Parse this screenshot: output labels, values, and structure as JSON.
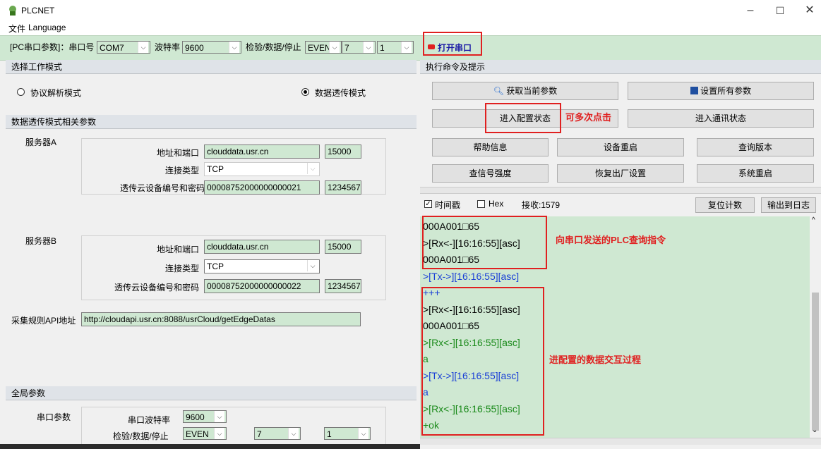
{
  "window": {
    "title": "PLCNET",
    "min": "–",
    "max": "☐",
    "close": "✕"
  },
  "menu": {
    "file": "文件",
    "language": "Language"
  },
  "toolbar": {
    "pc_params_label": "[PC串口参数]：串口号",
    "port": "COM7",
    "baud_label": "波特率",
    "baud": "9600",
    "parity_label": "检验/数据/停止",
    "parity": "EVEN",
    "databits": "7",
    "stopbits": "1",
    "open_port": "打开串口",
    "open_port_color": "#e02020"
  },
  "left": {
    "mode_section": "选择工作模式",
    "mode_protocol": "协议解析模式",
    "mode_transparent": "数据透传模式",
    "trans_section": "数据透传模式相关参数",
    "serverA": {
      "name": "服务器A",
      "addr_label": "地址和端口",
      "addr": "clouddata.usr.cn",
      "port": "15000",
      "conn_label": "连接类型",
      "conn": "TCP",
      "dev_label": "透传云设备编号和密码",
      "dev_id": "00008752000000000021",
      "dev_pwd": "1234567"
    },
    "serverB": {
      "name": "服务器B",
      "addr_label": "地址和端口",
      "addr": "clouddata.usr.cn",
      "port": "15000",
      "conn_label": "连接类型",
      "conn": "TCP",
      "dev_label": "透传云设备编号和密码",
      "dev_id": "00008752000000000022",
      "dev_pwd": "1234567"
    },
    "api_label": "采集规则API地址",
    "api_url": "http://cloudapi.usr.cn:8088/usrCloud/getEdgeDatas",
    "global_section": "全局参数",
    "serial_params": "串口参数",
    "g_baud_label": "串口波特率",
    "g_baud": "9600",
    "g_parity_label": "检验/数据/停止",
    "g_parity": "EVEN",
    "g_databits": "7",
    "g_stopbits": "1"
  },
  "right": {
    "cmd_section": "执行命令及提示",
    "btn_get_params": "获取当前参数",
    "btn_set_all": "设置所有参数",
    "btn_enter_config": "进入配置状态",
    "note_multi_click": "可多次点击",
    "btn_enter_comm": "进入通讯状态",
    "btn_help": "帮助信息",
    "btn_restart": "设备重启",
    "btn_version": "查询版本",
    "btn_signal": "查信号强度",
    "btn_factory": "恢复出厂设置",
    "btn_sys_restart": "系统重启",
    "timestamp_label": "时间戳",
    "hex_label": "Hex",
    "recv_label": "接收:1579",
    "btn_reset_count": "复位计数",
    "btn_export_log": "输出到日志",
    "annotation1": "向串口发送的PLC查询指令",
    "annotation2": "进配置的数据交互过程",
    "log": [
      {
        "text": "000A001□65",
        "color": "#000000"
      },
      {
        "text": ">[Rx<-][16:16:55][asc]",
        "color": "#000000"
      },
      {
        "text": "000A001□65",
        "color": "#000000"
      },
      {
        "text": ">[Tx->][16:16:55][asc]",
        "color": "#1a3fd6"
      },
      {
        "text": "+++",
        "color": "#1a3fd6"
      },
      {
        "text": ">[Rx<-][16:16:55][asc]",
        "color": "#000000"
      },
      {
        "text": "000A001□65",
        "color": "#000000"
      },
      {
        "text": ">[Rx<-][16:16:55][asc]",
        "color": "#1a8a1a"
      },
      {
        "text": "a",
        "color": "#1a8a1a"
      },
      {
        "text": ">[Tx->][16:16:55][asc]",
        "color": "#1a3fd6"
      },
      {
        "text": "a",
        "color": "#1a3fd6"
      },
      {
        "text": ">[Rx<-][16:16:55][asc]",
        "color": "#1a8a1a"
      },
      {
        "text": "+ok",
        "color": "#1a8a1a"
      }
    ]
  }
}
